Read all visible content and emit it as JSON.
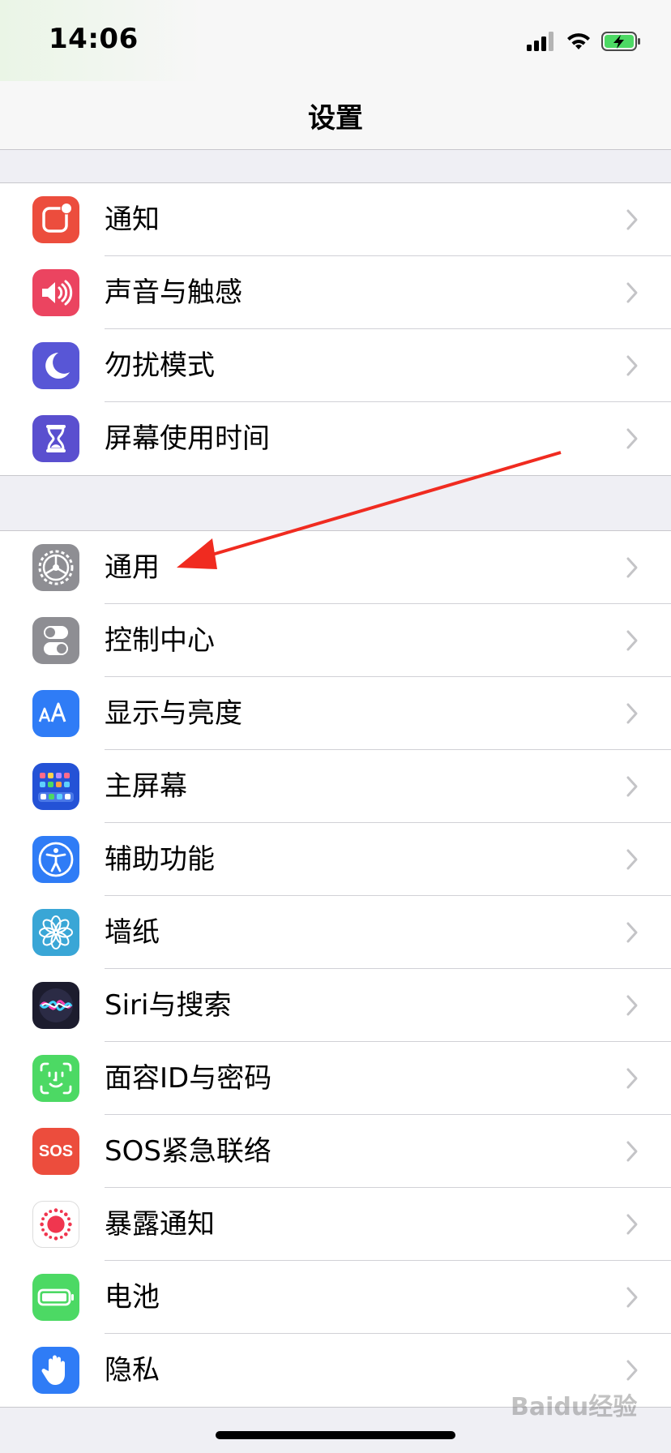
{
  "status_bar": {
    "time": "14:06",
    "signal_icon": "cellular-signal-icon",
    "wifi_icon": "wifi-icon",
    "battery_icon": "battery-charging-icon"
  },
  "nav": {
    "title": "设置"
  },
  "groups": [
    [
      {
        "label": "通知",
        "icon": "notifications-icon",
        "color": "#ec4d3d"
      },
      {
        "label": "声音与触感",
        "icon": "sound-icon",
        "color": "#eb4460"
      },
      {
        "label": "勿扰模式",
        "icon": "moon-icon",
        "color": "#5856d6"
      },
      {
        "label": "屏幕使用时间",
        "icon": "hourglass-icon",
        "color": "#5a4fcf"
      }
    ],
    [
      {
        "label": "通用",
        "icon": "gear-icon",
        "color": "#8e8e93"
      },
      {
        "label": "控制中心",
        "icon": "control-center-icon",
        "color": "#8e8e93"
      },
      {
        "label": "显示与亮度",
        "icon": "display-icon",
        "color": "#2f7cf6"
      },
      {
        "label": "主屏幕",
        "icon": "home-screen-icon",
        "color": "#2452d6"
      },
      {
        "label": "辅助功能",
        "icon": "accessibility-icon",
        "color": "#2f7cf6"
      },
      {
        "label": "墙纸",
        "icon": "wallpaper-icon",
        "color": "#39a6d6"
      },
      {
        "label": "Siri与搜索",
        "icon": "siri-icon",
        "color": "#1c1c2e"
      },
      {
        "label": "面容ID与密码",
        "icon": "face-id-icon",
        "color": "#4cd964"
      },
      {
        "label": "SOS紧急联络",
        "icon": "sos-icon",
        "color": "#ec4d3d"
      },
      {
        "label": "暴露通知",
        "icon": "exposure-icon",
        "color": "#ffffff"
      },
      {
        "label": "电池",
        "icon": "battery-icon",
        "color": "#4cd964"
      },
      {
        "label": "隐私",
        "icon": "hand-icon",
        "color": "#2f7cf6"
      }
    ]
  ],
  "sos_text": "SOS",
  "watermark": "Baidu经验",
  "annotation": {
    "arrow_color": "#f02b20"
  }
}
